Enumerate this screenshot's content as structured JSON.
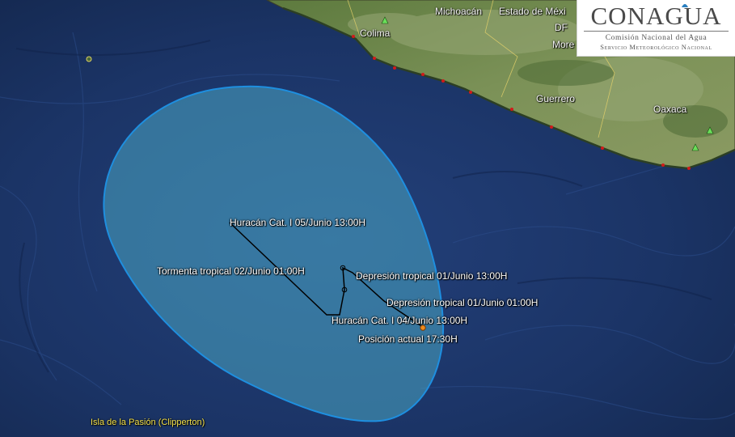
{
  "map": {
    "ocean_color": "#1c3468",
    "land_color": "#6f8a4e",
    "cone_fill": "#4aa8c4",
    "cone_stroke": "#1e8fe0",
    "track_color": "#000000",
    "current_position_color": "#f08a1c"
  },
  "places": {
    "michoacan": "Michoacán",
    "estado_de_mexico": "Estado de Méxi",
    "df": "DF",
    "morelos": "More",
    "colima": "Colima",
    "guerrero": "Guerrero",
    "oaxaca": "Oaxaca",
    "clipperton": "Isla de la Pasión (Clipperton)"
  },
  "track": {
    "huracan_05": "Huracán Cat. I 05/Junio 13:00H",
    "tormenta_02": "Tormenta tropical 02/Junio 01:00H",
    "depresion_01_13": "Depresión tropical 01/Junio 13:00H",
    "depresion_01_01": "Depresión tropical 01/Junio 01:00H",
    "huracan_04": "Huracán Cat. I 04/Junio 13:00H",
    "posicion_actual": "Posición actual 17:30H"
  },
  "logo": {
    "name": "CONAGUA",
    "line1": "Comisión Nacional del Agua",
    "line2": "Servicio Meteorológico Nacional"
  }
}
